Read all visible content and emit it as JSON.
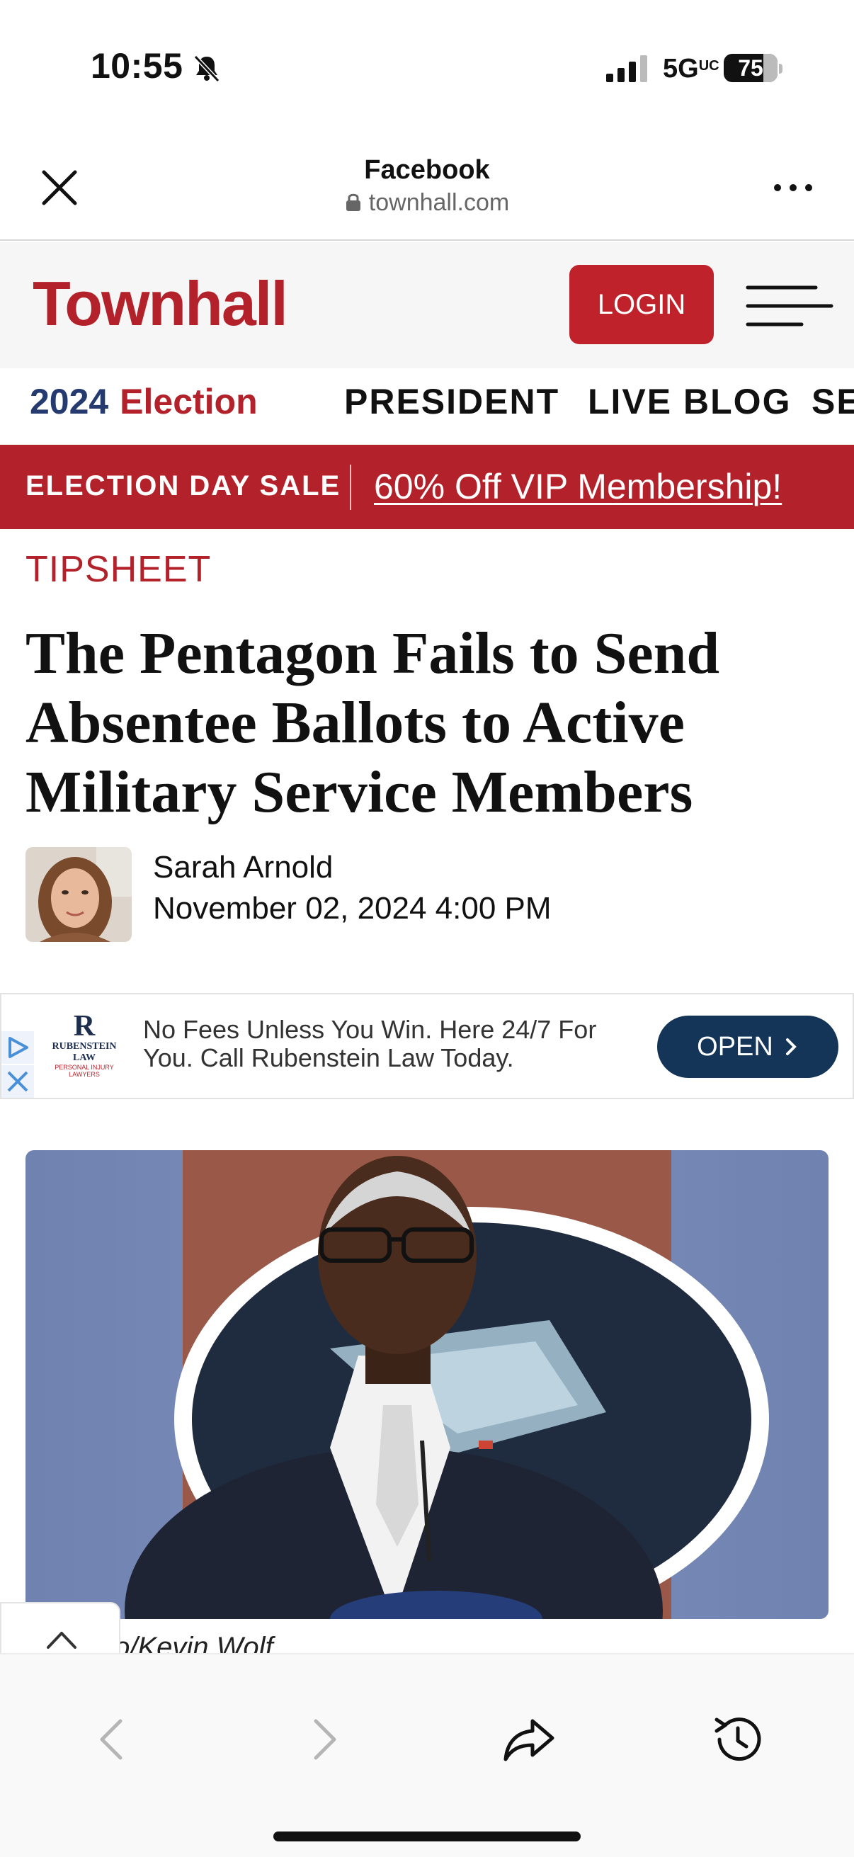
{
  "status_bar": {
    "time": "10:55",
    "network": "5G",
    "network_sup": "UC",
    "battery": "75"
  },
  "browser": {
    "title": "Facebook",
    "url": "townhall.com"
  },
  "site": {
    "logo": "Townhall",
    "login_label": "LOGIN",
    "brand_color": "#b3222b"
  },
  "nav": {
    "election_year": "2024",
    "election_word": "Election",
    "items": [
      "PRESIDENT",
      "LIVE BLOG",
      "SE"
    ]
  },
  "promo": {
    "label": "ELECTION DAY SALE",
    "link": "60% Off VIP Membership!"
  },
  "article": {
    "section": "TIPSHEET",
    "title": "The Pentagon Fails to Send Absentee Ballots to Active Military Service Members",
    "author": "Sarah Arnold",
    "date": "November 02, 2024 4:00 PM",
    "photo_credit": "to/Kevin Wolf"
  },
  "ad": {
    "logo_letter": "R",
    "logo_name": "RUBENSTEIN LAW",
    "logo_sub": "PERSONAL INJURY LAWYERS",
    "text": "No Fees Unless You Win. Here 24/7 For You. Call Rubenstein Law Today.",
    "button": "OPEN"
  },
  "toolbar": {
    "icons": [
      "back-icon",
      "forward-icon",
      "share-icon",
      "history-icon"
    ]
  }
}
